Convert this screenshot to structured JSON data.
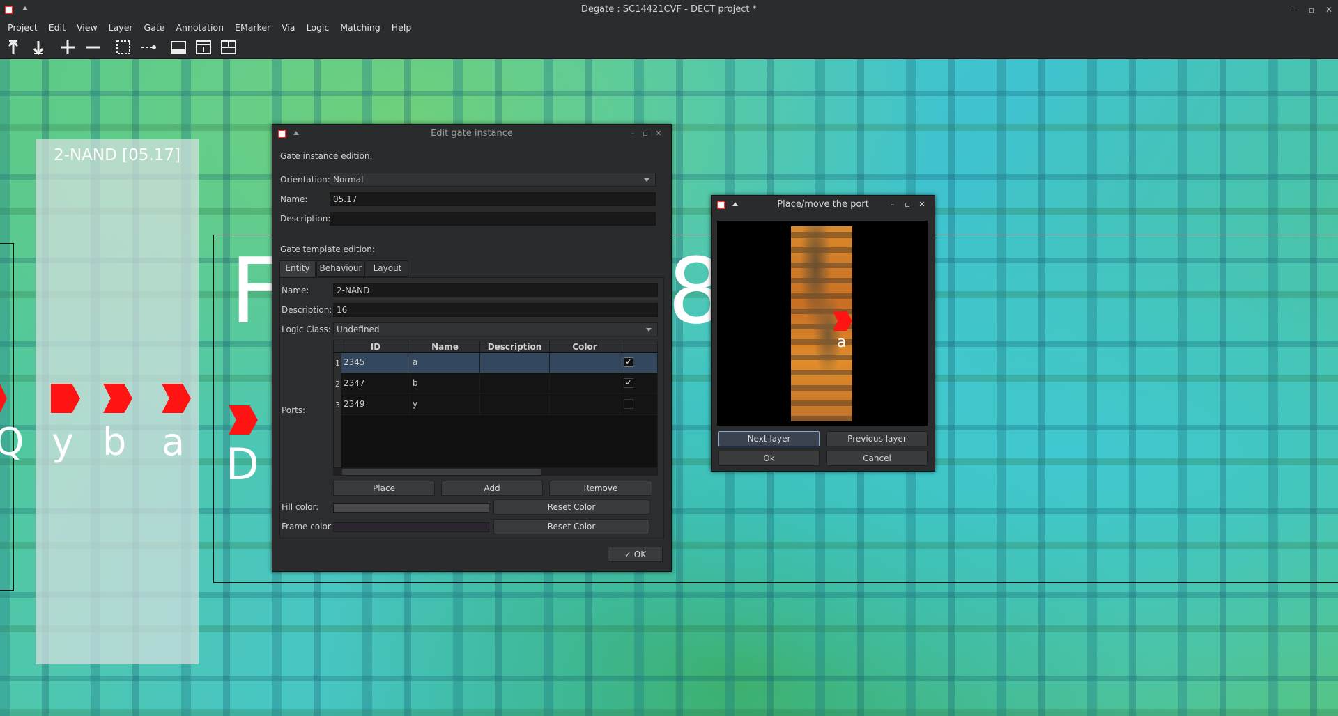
{
  "window": {
    "title": "Degate : SC14421CVF - DECT project *",
    "minimize": "–",
    "maximize": "▫",
    "close": "✕"
  },
  "menu": [
    "Project",
    "Edit",
    "View",
    "Layer",
    "Gate",
    "Annotation",
    "EMarker",
    "Via",
    "Logic",
    "Matching",
    "Help"
  ],
  "toolbar": {
    "icons": [
      "layer-up-icon",
      "layer-down-icon",
      "zoom-in-icon",
      "zoom-out-icon",
      "select-area-icon",
      "wire-tool-icon",
      "view-icon",
      "template-icon",
      "layout-icon"
    ]
  },
  "canvas": {
    "gate_label": "2-NAND [05.17]",
    "port_letters": [
      "Q",
      "y",
      "b",
      "a",
      "D"
    ],
    "big_letters": [
      "F",
      "8"
    ]
  },
  "edit_gate": {
    "title": "Edit gate instance",
    "instance_section": "Gate instance edition:",
    "orientation_label": "Orientation:",
    "orientation_value": "Normal",
    "name_label": "Name:",
    "name_value": "05.17",
    "description_label": "Description:",
    "description_value": "",
    "template_section": "Gate template edition:",
    "tabs": [
      "Entity",
      "Behaviour",
      "Layout"
    ],
    "entity": {
      "name_label": "Name:",
      "name_value": "2-NAND",
      "description_label": "Description:",
      "description_value": "16",
      "logic_class_label": "Logic Class:",
      "logic_class_value": "Undefined",
      "ports_label": "Ports:",
      "columns": [
        "ID",
        "Name",
        "Description",
        "Color"
      ],
      "rows": [
        {
          "num": "1",
          "id": "2345",
          "name": "a",
          "description": "",
          "color": "",
          "checked": true
        },
        {
          "num": "2",
          "id": "2347",
          "name": "b",
          "description": "",
          "color": "",
          "checked": true
        },
        {
          "num": "3",
          "id": "2349",
          "name": "y",
          "description": "",
          "color": "",
          "checked": false
        }
      ],
      "place_btn": "Place",
      "add_btn": "Add",
      "remove_btn": "Remove",
      "fill_color_label": "Fill color:",
      "frame_color_label": "Frame color:",
      "reset_color_btn": "Reset Color",
      "fill_color": "#4a4a4c",
      "frame_color": "#2c2530"
    },
    "ok_btn": "OK",
    "check_mark": "✓"
  },
  "place_port": {
    "title": "Place/move the port",
    "port_label": "a",
    "next_layer_btn": "Next layer",
    "prev_layer_btn": "Previous layer",
    "ok_btn": "Ok",
    "cancel_btn": "Cancel"
  },
  "colors": {
    "accent_red": "#ff1313",
    "selection": "#33475e"
  }
}
